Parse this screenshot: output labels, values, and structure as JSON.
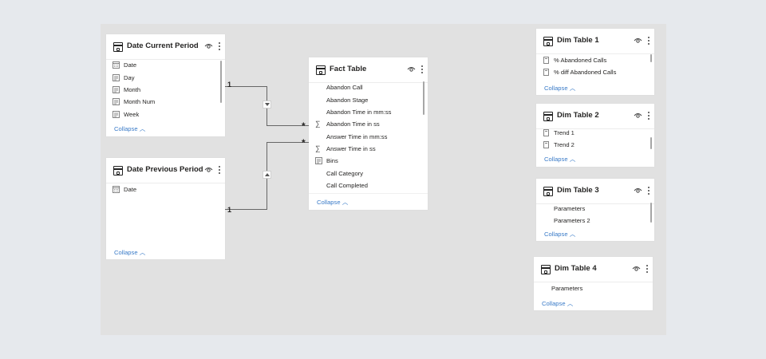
{
  "tables": {
    "date_current": {
      "title": "Date Current Period",
      "fields": [
        {
          "label": "Date",
          "icon": "calendar-icon"
        },
        {
          "label": "Day",
          "icon": "column-icon"
        },
        {
          "label": "Month",
          "icon": "column-icon"
        },
        {
          "label": "Month Num",
          "icon": "column-icon"
        },
        {
          "label": "Week",
          "icon": "column-icon"
        }
      ],
      "collapse": "Collapse"
    },
    "date_previous": {
      "title": "Date Previous Period",
      "fields": [
        {
          "label": "Date",
          "icon": "calendar-icon"
        }
      ],
      "collapse": "Collapse"
    },
    "fact": {
      "title": "Fact Table",
      "fields": [
        {
          "label": "Abandon Call",
          "icon": ""
        },
        {
          "label": "Abandon Stage",
          "icon": ""
        },
        {
          "label": "Abandon Time in mm:ss",
          "icon": ""
        },
        {
          "label": "Abandon Time in ss",
          "icon": "sigma-icon"
        },
        {
          "label": "Answer Time in mm:ss",
          "icon": ""
        },
        {
          "label": "Answer Time in ss",
          "icon": "sigma-icon"
        },
        {
          "label": "Bins",
          "icon": "column-icon"
        },
        {
          "label": "Call Category",
          "icon": ""
        },
        {
          "label": "Call Completed",
          "icon": ""
        }
      ],
      "collapse": "Collapse"
    },
    "dim1": {
      "title": "Dim Table 1",
      "fields": [
        {
          "label": "% Abandoned Calls",
          "icon": "measure-icon"
        },
        {
          "label": "% diff Abandoned Calls",
          "icon": "measure-icon"
        }
      ],
      "collapse": "Collapse"
    },
    "dim2": {
      "title": "Dim Table 2",
      "fields": [
        {
          "label": "Trend 1",
          "icon": "measure-icon"
        },
        {
          "label": "Trend 2",
          "icon": "measure-icon"
        }
      ],
      "collapse": "Collapse"
    },
    "dim3": {
      "title": "Dim Table 3",
      "fields": [
        {
          "label": "Parameters",
          "icon": ""
        },
        {
          "label": "Parameters 2",
          "icon": ""
        }
      ],
      "collapse": "Collapse"
    },
    "dim4": {
      "title": "Dim Table 4",
      "fields": [
        {
          "label": "Parameters",
          "icon": ""
        }
      ],
      "collapse": "Collapse"
    }
  },
  "relationships": {
    "one_label": "1",
    "many_label": "*"
  },
  "colors": {
    "link": "#3a7bc8",
    "canvas": "#e1e1e1",
    "line": "#666666"
  }
}
